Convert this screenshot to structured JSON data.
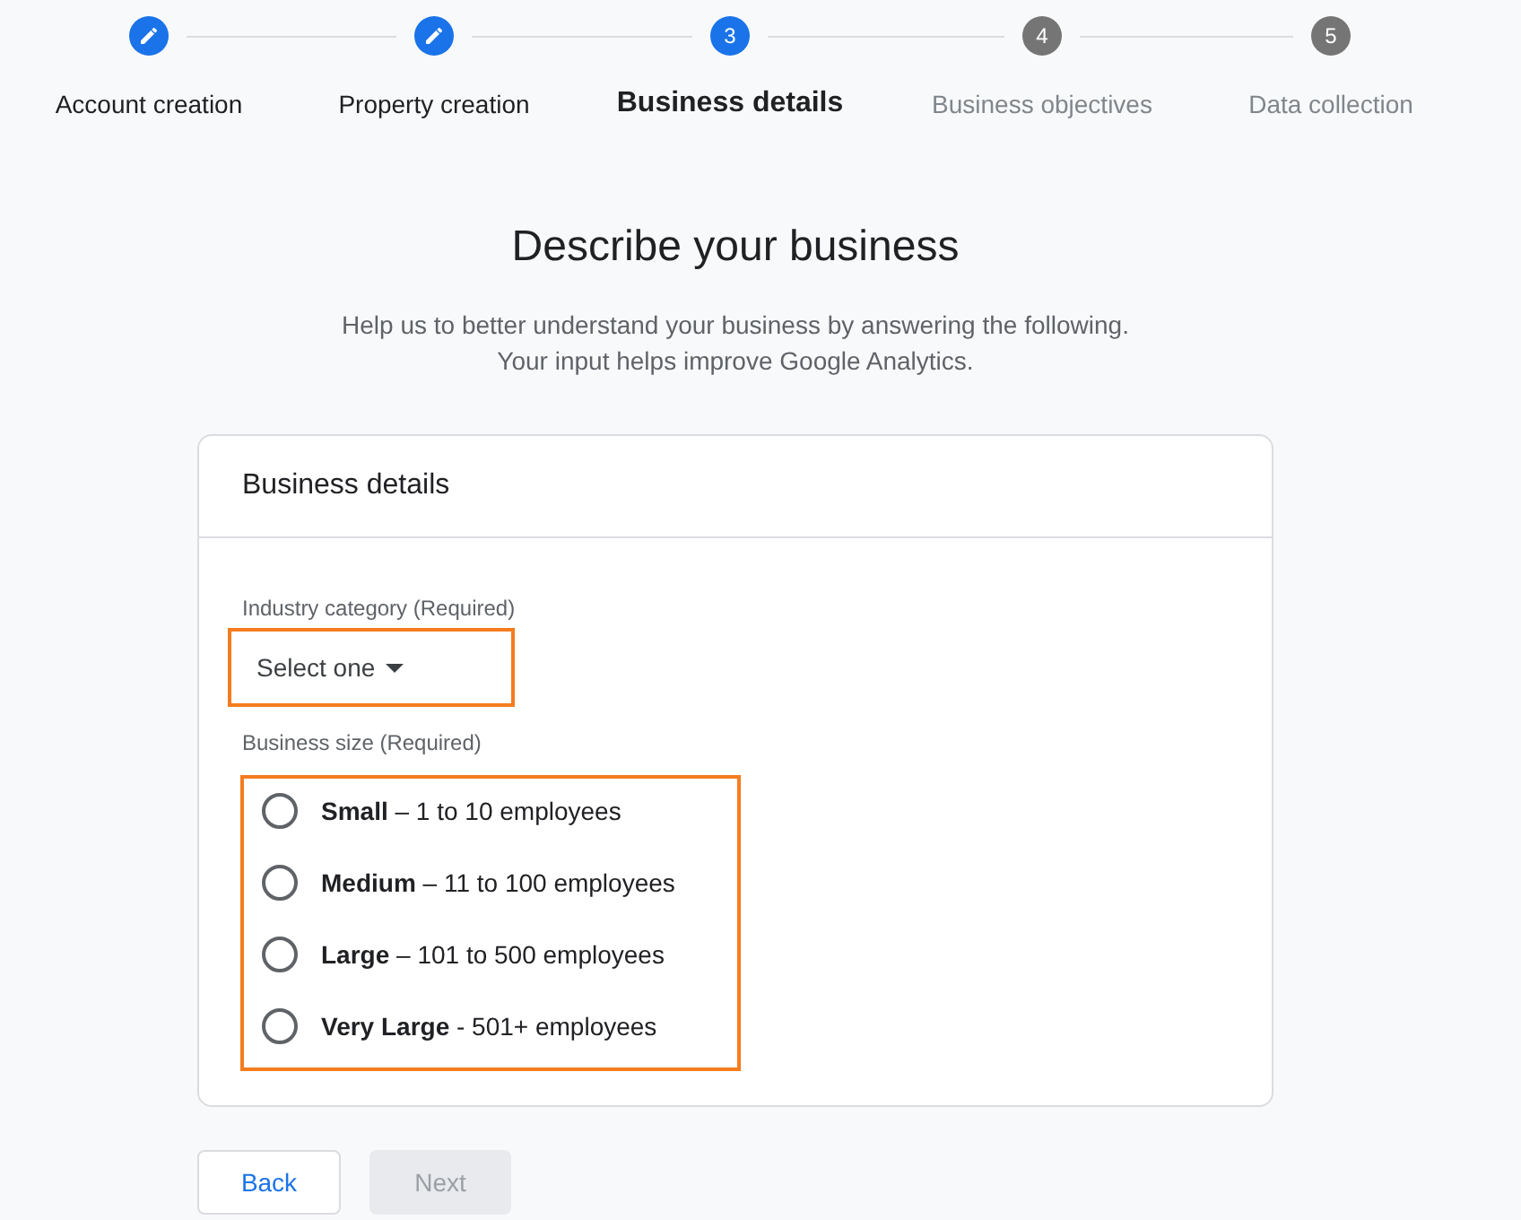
{
  "steps": [
    {
      "label": "Account creation",
      "completed": true,
      "selected": false
    },
    {
      "label": "Property creation",
      "completed": true,
      "selected": false
    },
    {
      "number": "3",
      "label": "Business details",
      "completed": false,
      "selected": true
    },
    {
      "number": "4",
      "label": "Business objectives",
      "completed": false,
      "selected": false
    },
    {
      "number": "5",
      "label": "Data collection",
      "completed": false,
      "selected": false
    }
  ],
  "heading": {
    "title": "Describe your business",
    "subtitle_lines": [
      "Help us to better understand your business by answering the following.",
      "Your input helps improve Google Analytics."
    ]
  },
  "card": {
    "title": "Business details",
    "industry": {
      "label": "Industry category (Required)",
      "placeholder": "Select one",
      "highlighted": true
    },
    "business_size": {
      "label": "Business size (Required)",
      "highlighted": true,
      "options": [
        {
          "label": "**Small** – 1 to 10 employees",
          "selected": false
        },
        {
          "label": "**Medium** – 11 to 100 employees",
          "selected": false
        },
        {
          "label": "**Large** – 101 to 500 employees",
          "selected": false
        },
        {
          "label": "**Very Large** - 501+ employees",
          "selected": false
        }
      ]
    }
  },
  "buttons": [
    {
      "label": "Back",
      "disabled": false
    },
    {
      "label": "Next",
      "disabled": true
    }
  ]
}
